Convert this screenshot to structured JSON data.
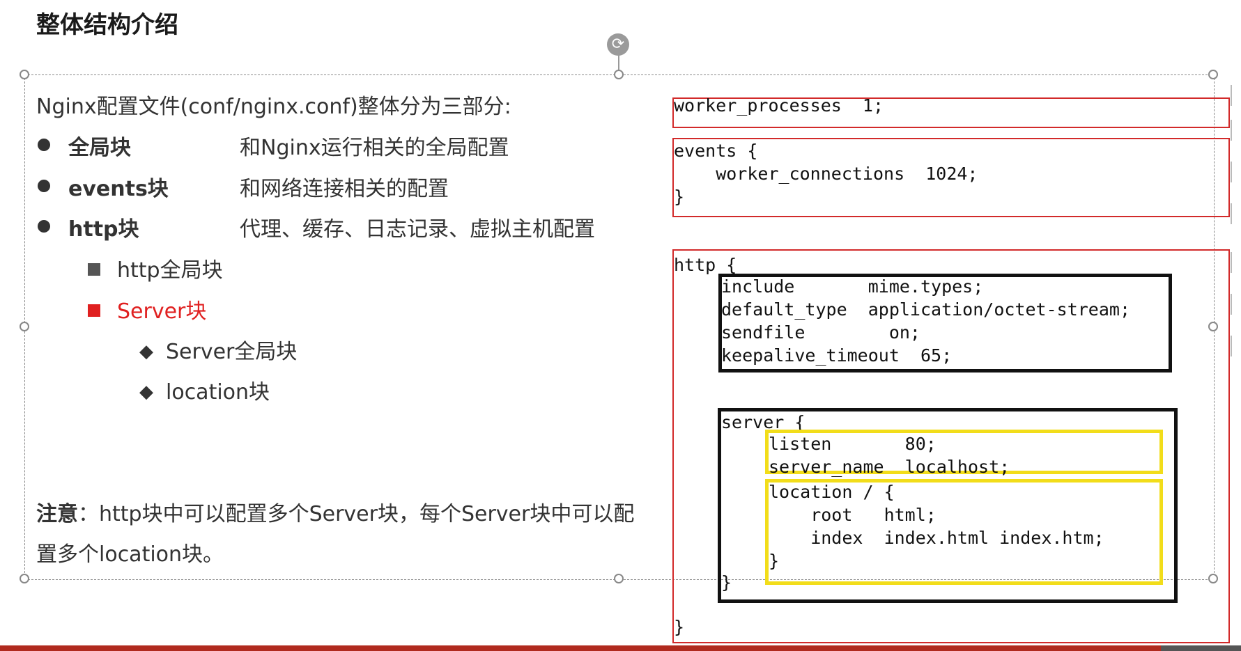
{
  "slide": {
    "title": "整体结构介绍"
  },
  "left": {
    "intro": "Nginx配置文件(conf/nginx.conf)整体分为三部分:",
    "bullets": [
      {
        "name": "全局块",
        "desc": "和Nginx运行相关的全局配置"
      },
      {
        "name": "events块",
        "desc": "和网络连接相关的配置"
      },
      {
        "name": "http块",
        "desc": "代理、缓存、日志记录、虚拟主机配置"
      }
    ],
    "sub_items": [
      {
        "label": "http全局块",
        "color": "#333333"
      },
      {
        "label": "Server块",
        "color": "#e02020"
      }
    ],
    "server_items": [
      {
        "label": "Server全局块"
      },
      {
        "label": "location块"
      }
    ],
    "note_label": "注意",
    "note_text": "：http块中可以配置多个Server块，每个Server块中可以配置多个location块。"
  },
  "code": {
    "worker_processes": "worker_processes  1;",
    "events_block": "events {\n    worker_connections  1024;\n}",
    "http_open": "http {",
    "http_settings": "include       mime.types;\ndefault_type  application/octet-stream;\nsendfile        on;\nkeepalive_timeout  65;",
    "server_open": "server {",
    "server_listen": "listen       80;\nserver_name  localhost;",
    "location_block": "location / {\n    root   html;\n    index  index.html index.htm;\n}",
    "server_close": "}",
    "http_close": "}"
  },
  "colors": {
    "red_border": "#d22a2a",
    "black_border": "#111111",
    "yellow_border": "#f2dd1a",
    "accent_red": "#e02020"
  }
}
